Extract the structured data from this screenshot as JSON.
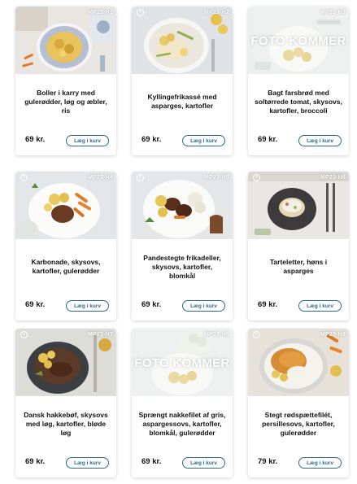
{
  "colors": {
    "button_border": "#2c6a86",
    "button_text": "#2c6a86",
    "card_bg": "#ffffff",
    "text": "#111111"
  },
  "products": [
    {
      "code": "MP23-H1",
      "name": "Boller i karry med gulerødder, løg og æbler, ris",
      "price": "69 kr.",
      "button": "Læg i kurv",
      "photo": "curry-meatballs-plate",
      "badge": false,
      "placeholder": false
    },
    {
      "code": "MP23-H2",
      "name": "Kyllingefrikassé med asparges, kartofler",
      "price": "69 kr.",
      "button": "Læg i kurv",
      "photo": "chicken-fricassee-plate",
      "badge": true,
      "placeholder": false
    },
    {
      "code": "MP23-H3",
      "name": "Bagt farsbrød med soltørrede tomat, skysovs, kartofler, broccoli",
      "price": "69 kr.",
      "button": "Læg i kurv",
      "photo": "placeholder-potatoes",
      "badge": false,
      "placeholder": true,
      "placeholder_text": "FOTO KOMMER"
    },
    {
      "code": "MP23-H4",
      "name": "Karbonade, skysovs, kartofler, gulerødder",
      "price": "69 kr.",
      "button": "Læg i kurv",
      "photo": "karbonade-plate",
      "badge": true,
      "placeholder": false
    },
    {
      "code": "MP23-H5",
      "name": "Pandestegte frikadeller, skysovs, kartofler, blomkål",
      "price": "69 kr.",
      "button": "Læg i kurv",
      "photo": "frikadeller-plate",
      "badge": true,
      "placeholder": false
    },
    {
      "code": "MP23-H6",
      "name": "Tarteletter, høns i asparges",
      "price": "69 kr.",
      "button": "Læg i kurv",
      "photo": "tartlets-plate",
      "badge": true,
      "placeholder": false
    },
    {
      "code": "MP23-H7",
      "name": "Dansk hakkebøf, skysovs med løg, kartofler, bløde løg",
      "price": "69 kr.",
      "button": "Læg i kurv",
      "photo": "hakkeboef-plate",
      "badge": true,
      "placeholder": false
    },
    {
      "code": "MP23-H8",
      "name": "Sprængt nakkefilet af gris, aspargessovs, kartofler, blomkål, gulerødder",
      "price": "69 kr.",
      "button": "Læg i kurv",
      "photo": "placeholder-cauliflower",
      "badge": false,
      "placeholder": true,
      "placeholder_text": "FOTO KOMMER"
    },
    {
      "code": "MP23-H9",
      "name": "Stegt rødspættefilét, persillesovs, kartofler, gulerødder",
      "price": "79 kr.",
      "button": "Læg i kurv",
      "photo": "plaice-fillet-plate",
      "badge": true,
      "placeholder": false
    }
  ]
}
